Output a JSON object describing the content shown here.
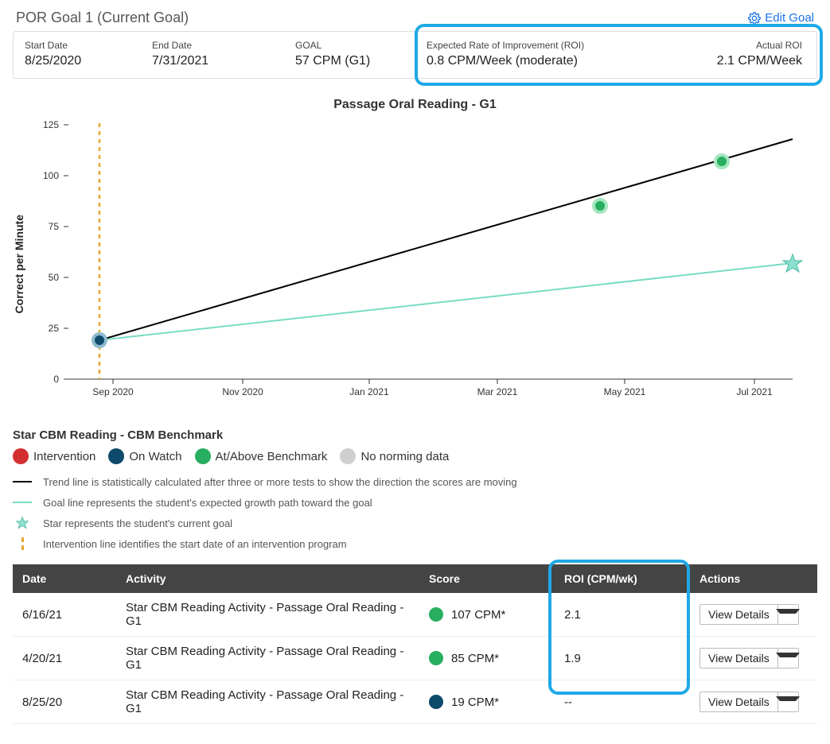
{
  "header": {
    "title": "POR Goal 1 (Current Goal)",
    "edit_label": "Edit Goal"
  },
  "info": {
    "start_label": "Start Date",
    "start_value": "8/25/2020",
    "end_label": "End Date",
    "end_value": "7/31/2021",
    "goal_label": "GOAL",
    "goal_value": "57 CPM (G1)",
    "expected_label": "Expected Rate of Improvement (ROI)",
    "expected_value": "0.8 CPM/Week (moderate)",
    "actual_label": "Actual ROI",
    "actual_value": "2.1 CPM/Week"
  },
  "chart_title": "Passage Oral Reading - G1",
  "chart_ylabel": "Correct per Minute",
  "chart_data": {
    "type": "line",
    "title": "Passage Oral Reading - G1",
    "xlabel": "",
    "ylabel": "Correct per Minute",
    "ylim": [
      0,
      125
    ],
    "x_ticks": [
      "Sep 2020",
      "Nov 2020",
      "Jan 2021",
      "Mar 2021",
      "May 2021",
      "Jul 2021"
    ],
    "y_ticks": [
      0,
      25,
      50,
      75,
      100,
      125
    ],
    "series": [
      {
        "name": "Trend line",
        "role": "trend",
        "style": "solid-black",
        "points": [
          {
            "x_label": "8/25/2020",
            "y": 19
          },
          {
            "x_label": "7/31/2021",
            "y": 118
          }
        ]
      },
      {
        "name": "Goal line",
        "role": "goal",
        "style": "solid-teal",
        "points": [
          {
            "x_label": "8/25/2020",
            "y": 19
          },
          {
            "x_label": "7/31/2021",
            "y": 57
          }
        ]
      }
    ],
    "data_points": [
      {
        "x_label": "8/25/2020",
        "y": 19,
        "status": "On Watch",
        "color": "#0d4a6b"
      },
      {
        "x_label": "4/20/2021",
        "y": 85,
        "status": "At/Above Benchmark",
        "color": "#27ae60"
      },
      {
        "x_label": "6/16/2021",
        "y": 107,
        "status": "At/Above Benchmark",
        "color": "#27ae60"
      }
    ],
    "goal_marker": {
      "x_label": "7/31/2021",
      "y": 57,
      "shape": "star"
    },
    "intervention_line_x": "8/25/2020"
  },
  "benchmark_heading": "Star CBM Reading - CBM Benchmark",
  "status_legend": {
    "intervention": "Intervention",
    "on_watch": "On Watch",
    "benchmark": "At/Above Benchmark",
    "no_norm": "No norming data"
  },
  "line_legend": {
    "trend": "Trend line is statistically calculated after three or more tests to show the direction the scores are moving",
    "goal": "Goal line represents the student's expected growth path toward the goal",
    "star": "Star represents the student's current goal",
    "intervention": "Intervention line identifies the start date of an intervention program"
  },
  "table": {
    "headers": {
      "date": "Date",
      "activity": "Activity",
      "score": "Score",
      "roi": "ROI (CPM/wk)",
      "actions": "Actions"
    },
    "rows": [
      {
        "date": "6/16/21",
        "activity": "Star CBM Reading Activity - Passage Oral Reading - G1",
        "score": "107 CPM*",
        "status_color": "#27ae60",
        "roi": "2.1"
      },
      {
        "date": "4/20/21",
        "activity": "Star CBM Reading Activity - Passage Oral Reading - G1",
        "score": "85 CPM*",
        "status_color": "#27ae60",
        "roi": "1.9"
      },
      {
        "date": "8/25/20",
        "activity": "Star CBM Reading Activity - Passage Oral Reading - G1",
        "score": "19 CPM*",
        "status_color": "#0d4a6b",
        "roi": "--"
      }
    ],
    "view_details_label": "View Details"
  }
}
